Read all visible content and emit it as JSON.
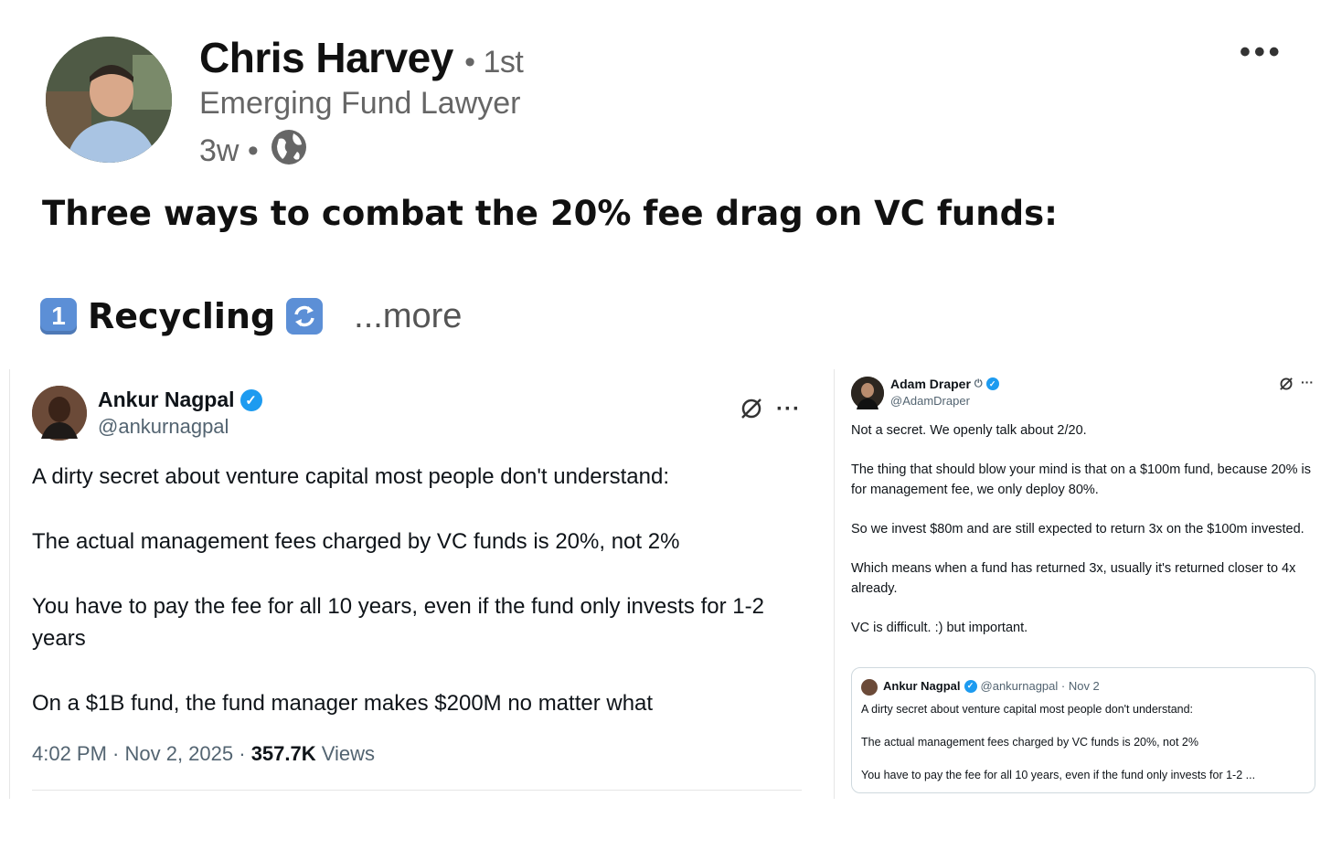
{
  "post": {
    "author": {
      "name": "Chris Harvey",
      "degree": "• 1st",
      "title": "Emerging Fund Lawyer",
      "age": "3w •"
    },
    "menu_icon": "more-horizontal-icon",
    "visibility_icon": "globe-icon",
    "headline": "Three ways to combat the 20% fee drag on VC funds:",
    "item": {
      "number": "1",
      "label": "Recycling",
      "icon": "cycle-arrows-icon"
    },
    "see_more": "...more"
  },
  "tweet_left": {
    "name": "Ankur Nagpal",
    "handle": "@ankurnagpal",
    "paragraphs": [
      "A dirty secret about venture capital most people don't understand:",
      "The actual management fees charged by VC funds is 20%, not 2%",
      "You have to pay the fee for all 10 years, even if the fund only invests for 1-2 years",
      "On a $1B fund, the fund manager makes $200M no matter what"
    ],
    "time": "4:02 PM · Nov 2, 2025 ·",
    "views_count": "357.7K",
    "views_label": "Views"
  },
  "tweet_right": {
    "name": "Adam Draper",
    "handle": "@AdamDraper",
    "paragraphs": [
      "Not a secret. We openly talk about 2/20.",
      "The thing that should blow your mind is that on a $100m fund, because 20% is for management fee, we only deploy 80%.",
      "So we invest $80m and are still expected to return 3x on the $100m invested.",
      "Which means when a fund has returned 3x, usually it's returned closer to 4x already.",
      "VC is difficult. :) but important."
    ],
    "quote": {
      "name": "Ankur Nagpal",
      "handle": "@ankurnagpal · Nov 2",
      "lines": [
        "A dirty secret about venture capital most people don't understand:",
        "The actual management fees charged by VC funds is 20%, not 2%",
        "You have to pay the fee for all 10 years, even if the fund only invests for 1-2 ..."
      ]
    }
  },
  "colors": {
    "verified": "#1d9bf0",
    "keycap": "#5c8fd6",
    "muted": "#536471"
  }
}
